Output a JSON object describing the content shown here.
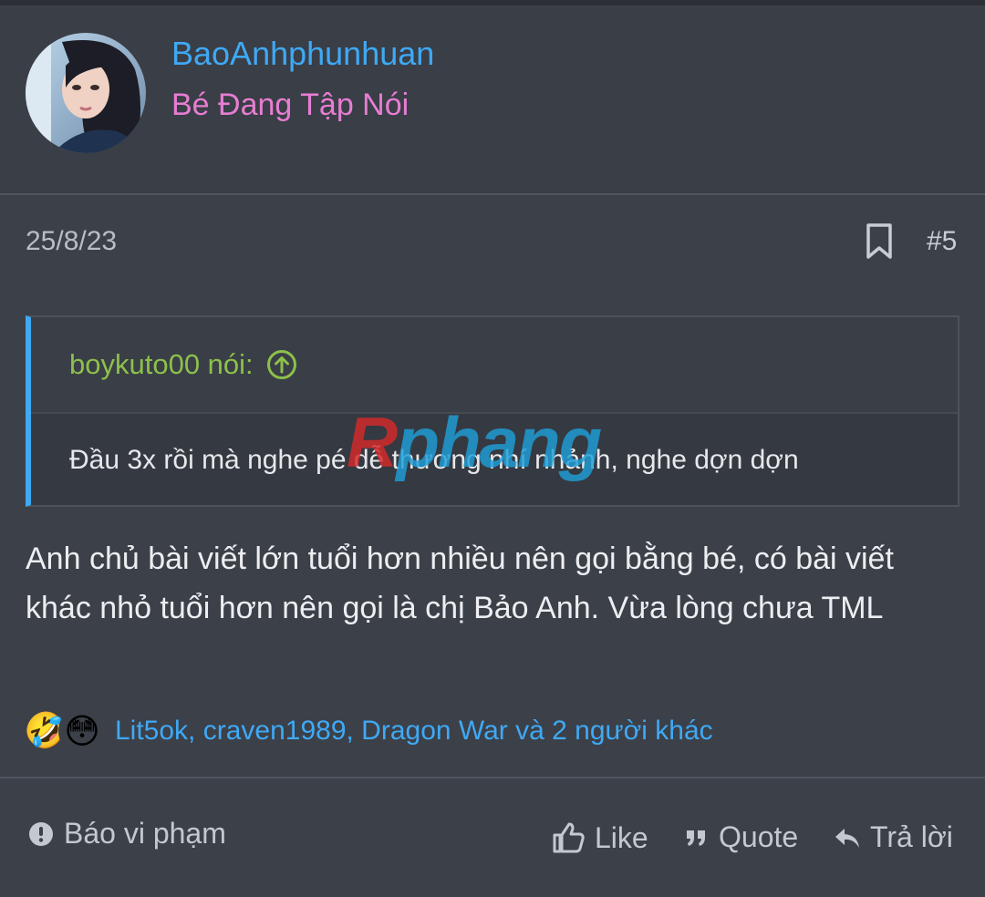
{
  "author": {
    "name": "BaoAnhphunhuan",
    "title": "Bé Đang Tập Nói",
    "name_color": "#3fa9f5",
    "title_color": "#e77dd2"
  },
  "post": {
    "date": "25/8/23",
    "number": "#5",
    "bookmark_icon": "bookmark-icon"
  },
  "quote": {
    "attribution": "boykuto00 nói:",
    "attribution_icon": "arrow-up-circle-icon",
    "text": "Đầu 3x rồi mà nghe pé dễ thương nhí nhảnh, nghe dợn dợn"
  },
  "watermark": {
    "part1": "R",
    "part2": "phang"
  },
  "body": {
    "text": "Anh chủ bài viết lớn tuổi hơn nhiều nên gọi bằng bé, có bài viết khác nhỏ tuổi hơn nên gọi là chị Bảo Anh. Vừa lòng chưa TML"
  },
  "reactions": {
    "emojis": [
      "🤣",
      "😳"
    ],
    "users": "Lit5ok, craven1989, Dragon War và 2 người khác"
  },
  "footer": {
    "report": "Báo vi phạm",
    "like": "Like",
    "quote": "Quote",
    "reply": "Trả lời"
  }
}
